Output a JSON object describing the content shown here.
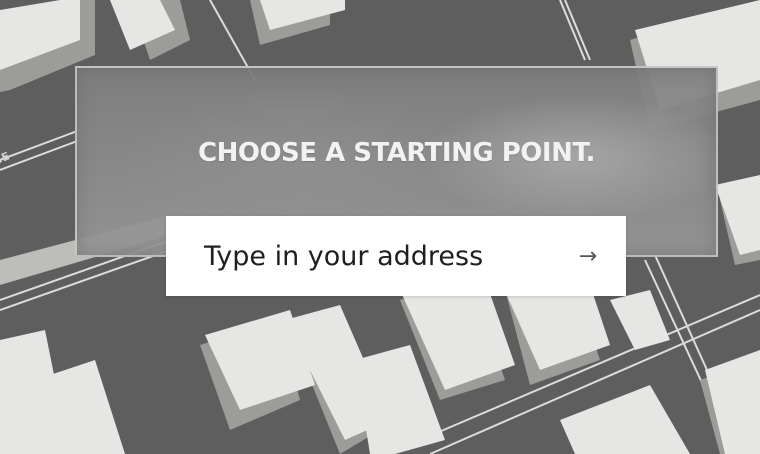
{
  "overlay": {
    "title": "CHOOSE A STARTING POINT."
  },
  "search": {
    "placeholder": "Type in your address",
    "submit_icon": "right-arrow-icon",
    "submit_glyph": "→"
  },
  "map": {
    "street_label": "SE",
    "colors": {
      "ground": "#5e5e5e",
      "building_top": "#e6e6e4",
      "building_side": "#9a9a96",
      "road": "#6a6a6a",
      "road_edge": "#d8d8d8"
    }
  }
}
